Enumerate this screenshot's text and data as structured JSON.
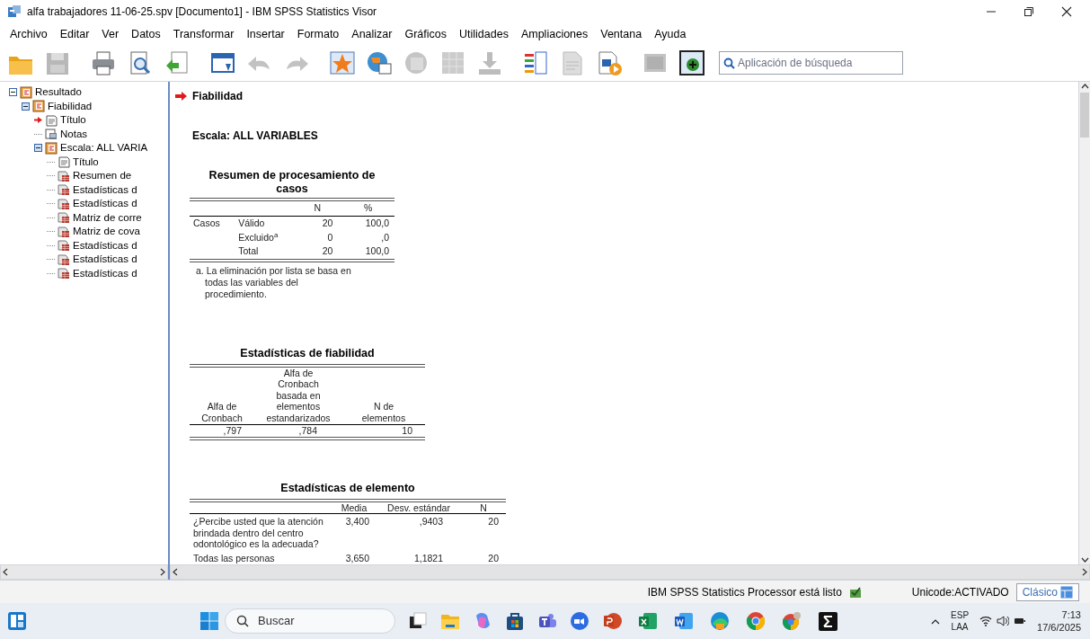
{
  "window": {
    "title": "alfa trabajadores 11-06-25.spv [Documento1] - IBM SPSS Statistics Visor"
  },
  "menu": [
    "Archivo",
    "Editar",
    "Ver",
    "Datos",
    "Transformar",
    "Insertar",
    "Formato",
    "Analizar",
    "Gráficos",
    "Utilidades",
    "Ampliaciones",
    "Ventana",
    "Ayuda"
  ],
  "toolbar": [
    {
      "kind": "open",
      "disabled": false
    },
    {
      "kind": "save",
      "disabled": true
    },
    {
      "kind": "print",
      "disabled": false
    },
    {
      "kind": "preview",
      "disabled": false
    },
    {
      "kind": "export",
      "disabled": false
    },
    {
      "kind": "window",
      "disabled": false
    },
    {
      "kind": "undo",
      "disabled": true
    },
    {
      "kind": "redo",
      "disabled": true
    },
    {
      "kind": "star",
      "disabled": false
    },
    {
      "kind": "globe",
      "disabled": false
    },
    {
      "kind": "pivot",
      "disabled": true
    },
    {
      "kind": "grid",
      "disabled": true
    },
    {
      "kind": "insert",
      "disabled": true
    },
    {
      "kind": "list",
      "disabled": false
    },
    {
      "kind": "doc",
      "disabled": true
    },
    {
      "kind": "play",
      "disabled": false
    },
    {
      "kind": "screen",
      "disabled": true
    },
    {
      "kind": "add",
      "disabled": false
    }
  ],
  "search": {
    "placeholder": "Aplicación de búsqueda"
  },
  "tree": [
    {
      "label": "Resultado",
      "kind": "log",
      "current": false,
      "expanded": true,
      "children": [
        {
          "label": "Fiabilidad",
          "kind": "heading",
          "current": false,
          "expanded": true,
          "children": [
            {
              "label": "Título",
              "kind": "title",
              "current": true
            },
            {
              "label": "Notas",
              "kind": "notes",
              "current": false
            },
            {
              "label": "Escala: ALL VARIA",
              "kind": "heading",
              "current": false,
              "expanded": true,
              "children": [
                {
                  "label": "Título",
                  "kind": "title",
                  "current": false
                },
                {
                  "label": "Resumen de",
                  "kind": "table",
                  "current": false
                },
                {
                  "label": "Estadísticas d",
                  "kind": "table",
                  "current": false
                },
                {
                  "label": "Estadísticas d",
                  "kind": "table",
                  "current": false
                },
                {
                  "label": "Matriz de corre",
                  "kind": "table",
                  "current": false
                },
                {
                  "label": "Matriz de cova",
                  "kind": "table",
                  "current": false
                },
                {
                  "label": "Estadísticas d",
                  "kind": "table",
                  "current": false
                },
                {
                  "label": "Estadísticas d",
                  "kind": "table",
                  "current": false
                },
                {
                  "label": "Estadísticas d",
                  "kind": "table",
                  "current": false
                }
              ]
            }
          ]
        }
      ]
    }
  ],
  "output": {
    "heading": "Fiabilidad",
    "scale": "Escala: ALL VARIABLES",
    "case_summary": {
      "title": "Resumen de procesamiento de casos",
      "columns": [
        "N",
        "%"
      ],
      "group": "Casos",
      "rows": [
        {
          "label": "Válido",
          "values": [
            "20",
            "100,0"
          ]
        },
        {
          "label": "Excluido$^{a}$",
          "values": [
            "0",
            ",0"
          ]
        },
        {
          "label": "Total",
          "values": [
            "20",
            "100,0"
          ]
        }
      ],
      "footnote": "a. La eliminación por lista se basa en todas las variables del procedimiento."
    },
    "reliability": {
      "title": "Estadísticas de fiabilidad",
      "columns": [
        "Alfa de Cronbach",
        "Alfa de Cronbach basada en elementos estandarizados",
        "N de elementos"
      ],
      "values": [
        ",797",
        ",784",
        "10"
      ]
    },
    "item_stats": {
      "title": "Estadísticas de elemento",
      "columns": [
        "Media",
        "Desv. estándar",
        "N"
      ],
      "rows": [
        {
          "label": "¿Percibe usted que la atención brindada dentro del centro odontológico es la adecuada?",
          "values": [
            "3,400",
            ",9403",
            "20"
          ]
        },
        {
          "label": "Todas las personas",
          "values": [
            "3,650",
            "1,1821",
            "20"
          ]
        }
      ]
    }
  },
  "status_bar": {
    "message": "IBM SPSS Statistics Processor está listo",
    "unicode": "Unicode:ACTIVADO",
    "mode_button": "Clásico"
  },
  "taskbar": {
    "search": "Buscar",
    "language": "ESP",
    "layout": "LAA",
    "time": "7:13",
    "date": "17/6/2025"
  }
}
